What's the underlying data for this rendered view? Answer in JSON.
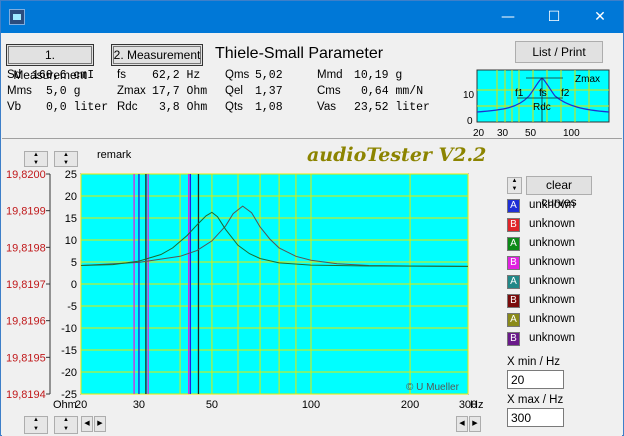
{
  "window": {
    "minimize_glyph": "—",
    "maximize_glyph": "☐",
    "close_glyph": "✕"
  },
  "toolbar": {
    "measurement1_label": "1. Measurement",
    "measurement2_label": "2. Measurement",
    "section_title": "Thiele-Small Parameter",
    "list_print_label": "List / Print"
  },
  "ts_params": {
    "sd_label": "Sd",
    "sd_value": "160,6 cmI",
    "mms_label": "Mms",
    "mms_value": "5,0 g",
    "vb_label": "Vb",
    "vb_value": "0,0 liter",
    "fs_label": "fs",
    "fs_value": "62,2 Hz",
    "zmax_label": "Zmax",
    "zmax_value": "17,7 Ohm",
    "rdc_label": "Rdc",
    "rdc_value": "3,8 Ohm",
    "qms_label": "Qms",
    "qms_value": "5,02",
    "qel_label": "Qel",
    "qel_value": "1,37",
    "qts_label": "Qts",
    "qts_value": "1,08",
    "mmd_label": "Mmd",
    "mmd_value": "10,19 g",
    "cms_label": "Cms",
    "cms_value": "0,64 mm/N",
    "vas_label": "Vas",
    "vas_value": "23,52 liter"
  },
  "mini_chart": {
    "y_top": "10",
    "y_bottom": "0",
    "x_ticks": [
      "20",
      "30",
      "50",
      "100"
    ],
    "labels": {
      "zmax": "Zmax",
      "f1": "f1",
      "fs": "fs",
      "f2": "f2",
      "rdc": "Rdc"
    }
  },
  "main": {
    "title": "audioTester V2.2",
    "remark_label": "remark",
    "copyright": "© U Mueller",
    "y_unit": "Ohm",
    "x_unit": "Hz",
    "left_axis_ticks": [
      "19,8200",
      "19,8199",
      "19,8198",
      "19,8197",
      "19,8196",
      "19,8195",
      "19,8194"
    ],
    "clear_curves_label": "clear curves",
    "xmin_label": "X min / Hz",
    "xmin_value": "20",
    "xmax_label": "X max / Hz",
    "xmax_value": "300"
  },
  "legend": [
    {
      "letter": "A",
      "label": "unknown",
      "color": "#1f2fd6"
    },
    {
      "letter": "B",
      "label": "unknown",
      "color": "#e0242a"
    },
    {
      "letter": "A",
      "label": "unknown",
      "color": "#0c8a17"
    },
    {
      "letter": "B",
      "label": "unknown",
      "color": "#e020e0"
    },
    {
      "letter": "A",
      "label": "unknown",
      "color": "#218888"
    },
    {
      "letter": "B",
      "label": "unknown",
      "color": "#7a0b0b"
    },
    {
      "letter": "A",
      "label": "unknown",
      "color": "#8a8a1a"
    },
    {
      "letter": "B",
      "label": "unknown",
      "color": "#6a1a8a"
    }
  ],
  "chart_data": {
    "type": "line",
    "x_scale": "log",
    "xlim": [
      20,
      300
    ],
    "ylim": [
      -25,
      25
    ],
    "x_ticks": [
      20,
      30,
      50,
      100,
      200,
      300
    ],
    "y_ticks": [
      25,
      20,
      15,
      10,
      5,
      0,
      -5,
      -10,
      -15,
      -20,
      -25
    ],
    "grid": true,
    "background": "#00ffff",
    "grid_color": "#e8e800",
    "series": [
      {
        "color": "#555555",
        "x": [
          20,
          30,
          40,
          45,
          50,
          55,
          58,
          62,
          66,
          70,
          75,
          80,
          90,
          100,
          120,
          150,
          200,
          300
        ],
        "y": [
          4.2,
          4.9,
          6.3,
          7.6,
          9.8,
          13.2,
          16.0,
          17.7,
          16.2,
          13.0,
          10.2,
          8.2,
          6.3,
          5.4,
          4.6,
          4.2,
          4.1,
          4.0
        ]
      },
      {
        "color": "#1b6b2e",
        "x": [
          20,
          25,
          30,
          35,
          38,
          42,
          45,
          48,
          50,
          52,
          55,
          60,
          65,
          70,
          80,
          100,
          150,
          300
        ],
        "y": [
          4.2,
          4.4,
          5.2,
          6.7,
          8.2,
          11.0,
          13.4,
          15.5,
          16.3,
          15.3,
          12.4,
          8.8,
          6.9,
          5.8,
          4.8,
          4.3,
          4.1,
          4.0
        ]
      }
    ],
    "markers": [
      {
        "x": 29.0,
        "color": "#e020e0"
      },
      {
        "x": 30.0,
        "color": "#2020e0"
      },
      {
        "x": 31.5,
        "color": "#202020"
      },
      {
        "x": 32.0,
        "color": "#e020e0"
      },
      {
        "x": 42.5,
        "color": "#e020e0"
      },
      {
        "x": 43.0,
        "color": "#2020e0"
      },
      {
        "x": 45.5,
        "color": "#202020"
      }
    ]
  }
}
